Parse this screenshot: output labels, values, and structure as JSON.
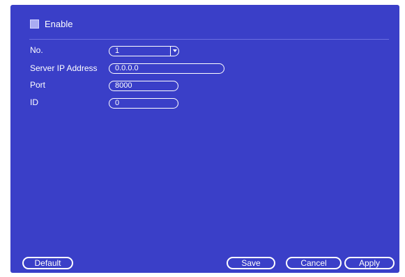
{
  "enable": {
    "label": "Enable",
    "checked": false
  },
  "fields": {
    "no": {
      "label": "No.",
      "value": "1"
    },
    "server_ip": {
      "label": "Server IP Address",
      "value": "0.0.0.0"
    },
    "port": {
      "label": "Port",
      "value": "8000"
    },
    "id": {
      "label": "ID",
      "value": "0"
    }
  },
  "buttons": {
    "default": "Default",
    "save": "Save",
    "cancel": "Cancel",
    "apply": "Apply"
  },
  "colors": {
    "panel": "#3a3fc8",
    "checkbox": "#a9acf2",
    "text": "#ffffff"
  }
}
